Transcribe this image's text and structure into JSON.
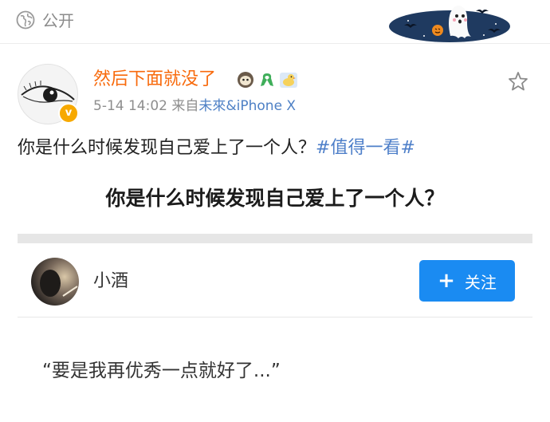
{
  "header": {
    "visibility_label": "公开",
    "decoration": "halloween-ghost-bats-banner"
  },
  "post": {
    "author": "然后下面就没了",
    "author_emojis": [
      "sheep-emoji",
      "green-ribbon-emoji",
      "duck-emoji"
    ],
    "verified_badge": "v",
    "meta_time": "5-14 14:02  来自",
    "meta_source": "未來&iPhone X",
    "text": "你是什么时候发现自己爱上了一个人？",
    "hashtag": "#值得一看#",
    "favorite_icon": "star-outline-icon"
  },
  "card": {
    "title": "你是什么时候发现自己爱上了一个人？"
  },
  "answer": {
    "author": "小酒",
    "follow_label": "关注",
    "follow_icon": "+",
    "quote": "“要是我再优秀一点就好了...”"
  },
  "colors": {
    "username": "#f86a0c",
    "link": "#4e80c5",
    "follow_button": "#1a8bf2",
    "separator": "#e6e6e6"
  }
}
